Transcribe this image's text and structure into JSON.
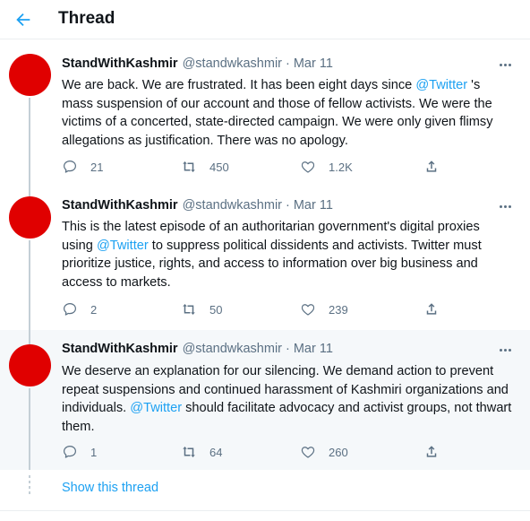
{
  "header": {
    "title": "Thread"
  },
  "tweets": [
    {
      "name": "StandWithKashmir",
      "handle": "@standwkashmir",
      "dot": "·",
      "date": "Mar 11",
      "text_lines": [
        "We are back. We are frustrated. It has been eight days since ",
        "@Twitter",
        " 's mass suspension of our account and those of fellow activists. We were the victims of a concerted, state-directed campaign. We were only given flimsy allegations as justification. There was no apology."
      ],
      "replies": "21",
      "retweets": "450",
      "likes": "1.2K"
    },
    {
      "name": "StandWithKashmir",
      "handle": "@standwkashmir",
      "dot": "·",
      "date": "Mar 11",
      "text_lines": [
        "This is the latest episode of an authoritarian government's digital proxies using ",
        "@Twitter",
        " to suppress political dissidents and activists. Twitter must prioritize justice, rights, and access to information over big business and access to markets."
      ],
      "replies": "2",
      "retweets": "50",
      "likes": "239"
    },
    {
      "name": "StandWithKashmir",
      "handle": "@standwkashmir",
      "dot": "·",
      "date": "Mar 11",
      "text_lines": [
        "We deserve an explanation for our silencing. We demand action to prevent repeat suspensions and continued harassment of Kashmiri organizations and individuals. ",
        "@Twitter",
        " should facilitate advocacy and activist groups, not thwart them."
      ],
      "replies": "1",
      "retweets": "64",
      "likes": "260"
    }
  ],
  "show_thread": "Show this thread",
  "icons": {
    "back": "arrow-left-icon",
    "more": "more-horizontal-icon",
    "reply": "reply-icon",
    "retweet": "retweet-icon",
    "like": "heart-icon",
    "share": "share-icon"
  },
  "colors": {
    "accent": "#1da1f2",
    "avatar": "#e00000",
    "muted": "#5b7083",
    "text": "#0f1419",
    "highlight_bg": "#f5f8fa"
  }
}
